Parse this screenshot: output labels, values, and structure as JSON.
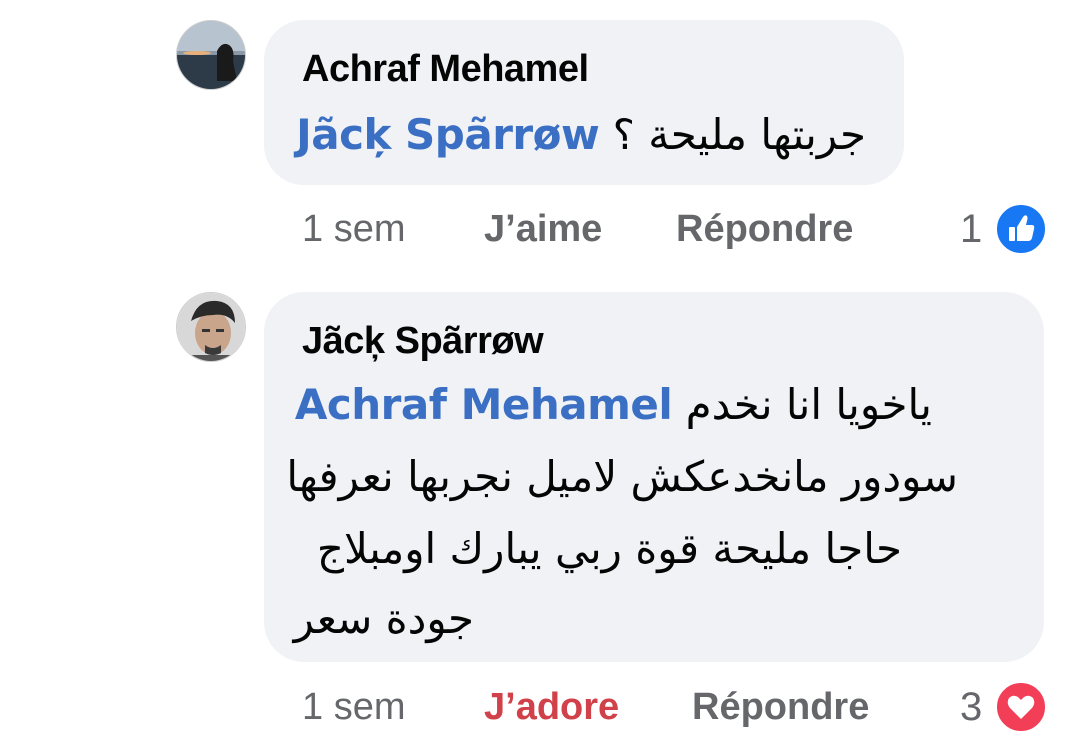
{
  "comments": [
    {
      "author": "Achraf Mehamel",
      "mention": "Jãcķ Spãrrøw",
      "text_lines": [
        "جربتها مليحة ؟"
      ],
      "time": "1 sem",
      "reaction_action": "J’aime",
      "reply_label": "Répondre",
      "reaction_count": "1",
      "reaction_type": "like-icon",
      "reaction_color": "#1877f2"
    },
    {
      "author": "Jãcķ Spãrrøw",
      "mention": "Achraf Mehamel",
      "text_lines": [
        "ياخويا انا نخدم",
        "سودور مانخدعكش لاميل نجربها نعرفها",
        "حاجا مليحة قوة  ربي يبارك اومبلاج",
        "جودة سعر"
      ],
      "time": "1 sem",
      "reaction_action": "J’adore",
      "reply_label": "Répondre",
      "reaction_count": "3",
      "reaction_type": "heart-icon",
      "reaction_color": "#f33e58"
    }
  ]
}
